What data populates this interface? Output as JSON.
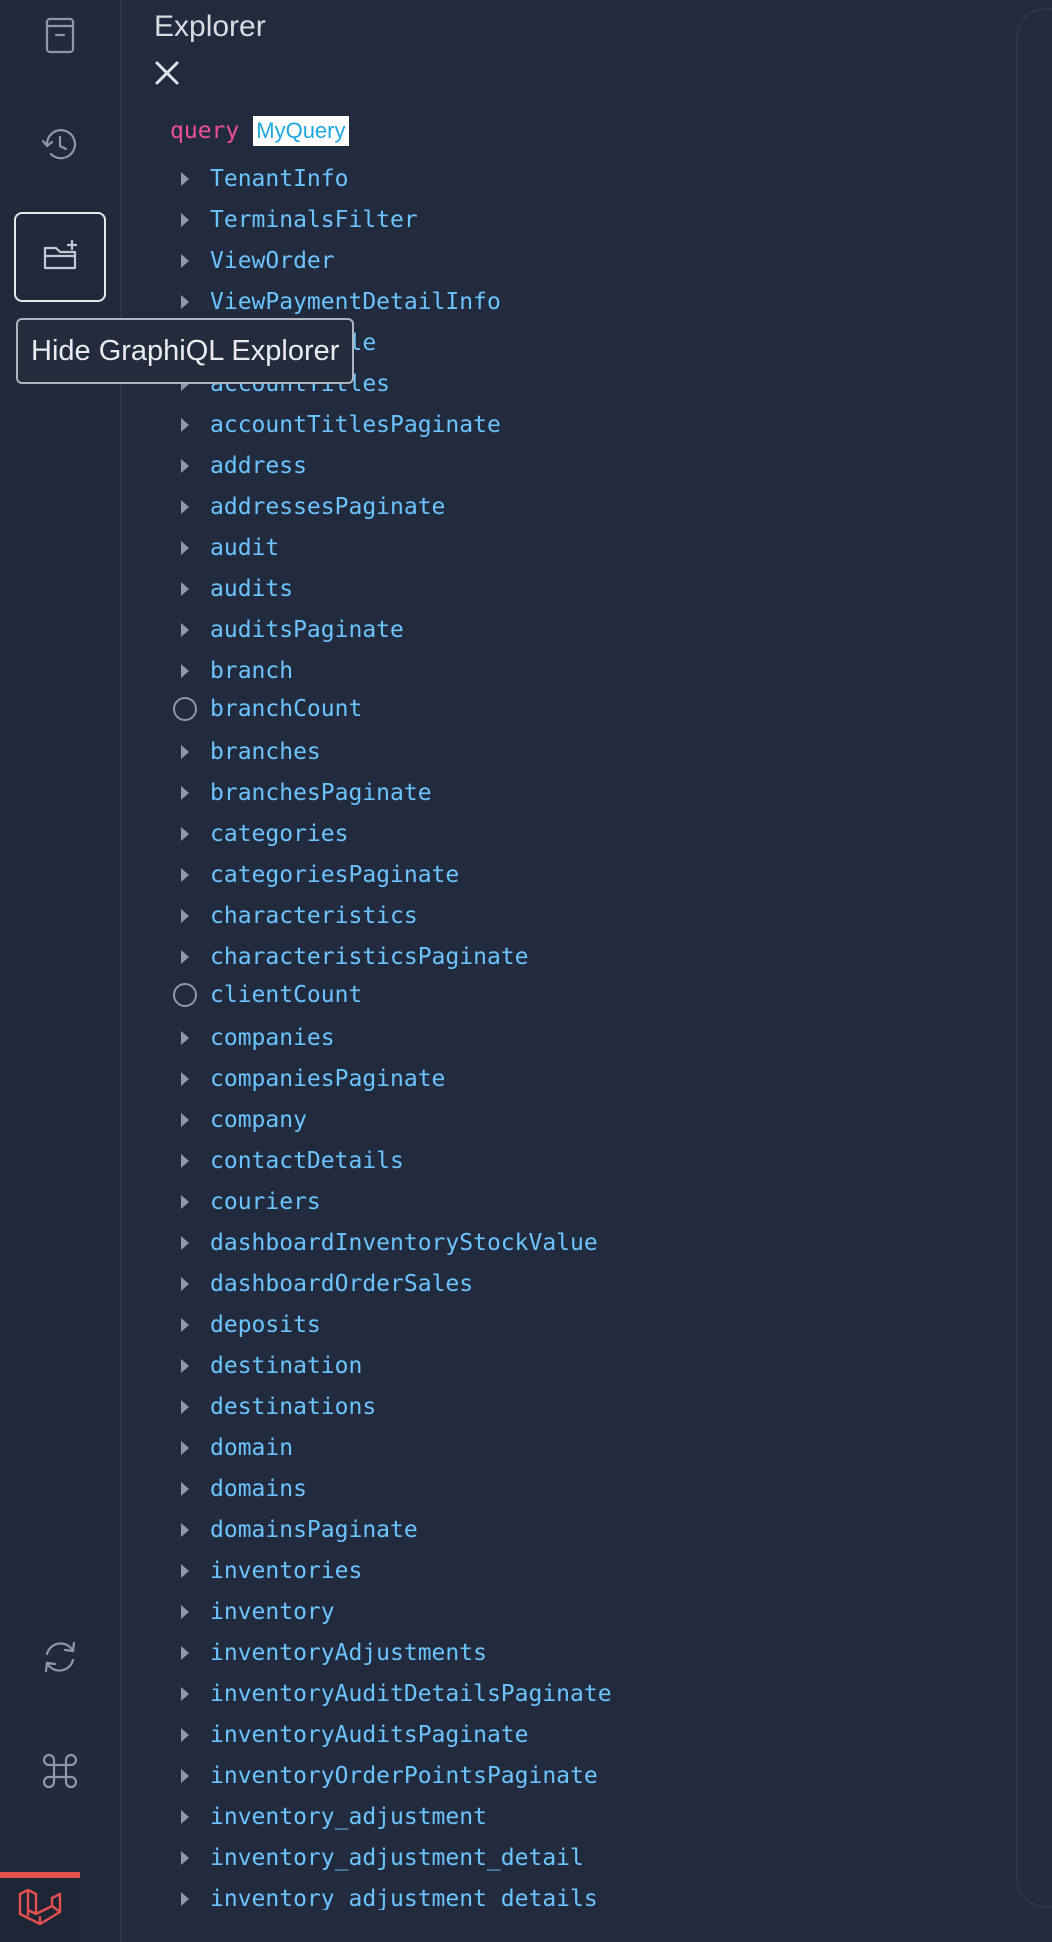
{
  "sidebar": {
    "tooltip": "Hide GraphiQL Explorer",
    "icons": [
      "docs-icon",
      "history-icon",
      "explorer-folder-plus-icon",
      "refresh-icon",
      "command-icon",
      "laravel-logo-icon"
    ]
  },
  "explorer": {
    "title": "Explorer",
    "close_label": "×",
    "operation_keyword": "query",
    "operation_name": "MyQuery",
    "fields": [
      {
        "name": "TenantInfo",
        "kind": "object"
      },
      {
        "name": "TerminalsFilter",
        "kind": "object"
      },
      {
        "name": "ViewOrder",
        "kind": "object"
      },
      {
        "name": "ViewPaymentDetailInfo",
        "kind": "object"
      },
      {
        "name": "accountTitle",
        "kind": "object"
      },
      {
        "name": "accountTitles",
        "kind": "object"
      },
      {
        "name": "accountTitlesPaginate",
        "kind": "object"
      },
      {
        "name": "address",
        "kind": "object"
      },
      {
        "name": "addressesPaginate",
        "kind": "object"
      },
      {
        "name": "audit",
        "kind": "object"
      },
      {
        "name": "audits",
        "kind": "object"
      },
      {
        "name": "auditsPaginate",
        "kind": "object"
      },
      {
        "name": "branch",
        "kind": "object"
      },
      {
        "name": "branchCount",
        "kind": "scalar"
      },
      {
        "name": "branches",
        "kind": "object"
      },
      {
        "name": "branchesPaginate",
        "kind": "object"
      },
      {
        "name": "categories",
        "kind": "object"
      },
      {
        "name": "categoriesPaginate",
        "kind": "object"
      },
      {
        "name": "characteristics",
        "kind": "object"
      },
      {
        "name": "characteristicsPaginate",
        "kind": "object"
      },
      {
        "name": "clientCount",
        "kind": "scalar"
      },
      {
        "name": "companies",
        "kind": "object"
      },
      {
        "name": "companiesPaginate",
        "kind": "object"
      },
      {
        "name": "company",
        "kind": "object"
      },
      {
        "name": "contactDetails",
        "kind": "object"
      },
      {
        "name": "couriers",
        "kind": "object"
      },
      {
        "name": "dashboardInventoryStockValue",
        "kind": "object"
      },
      {
        "name": "dashboardOrderSales",
        "kind": "object"
      },
      {
        "name": "deposits",
        "kind": "object"
      },
      {
        "name": "destination",
        "kind": "object"
      },
      {
        "name": "destinations",
        "kind": "object"
      },
      {
        "name": "domain",
        "kind": "object"
      },
      {
        "name": "domains",
        "kind": "object"
      },
      {
        "name": "domainsPaginate",
        "kind": "object"
      },
      {
        "name": "inventories",
        "kind": "object"
      },
      {
        "name": "inventory",
        "kind": "object"
      },
      {
        "name": "inventoryAdjustments",
        "kind": "object"
      },
      {
        "name": "inventoryAuditDetailsPaginate",
        "kind": "object"
      },
      {
        "name": "inventoryAuditsPaginate",
        "kind": "object"
      },
      {
        "name": "inventoryOrderPointsPaginate",
        "kind": "object"
      },
      {
        "name": "inventory_adjustment",
        "kind": "object"
      },
      {
        "name": "inventory_adjustment_detail",
        "kind": "object"
      },
      {
        "name": "inventory_adjustment_details",
        "kind": "object"
      }
    ]
  },
  "colors": {
    "background": "#222b3d",
    "field_text": "#6cc4ff",
    "keyword": "#ec4f9a",
    "laravel_red": "#e2514d"
  }
}
